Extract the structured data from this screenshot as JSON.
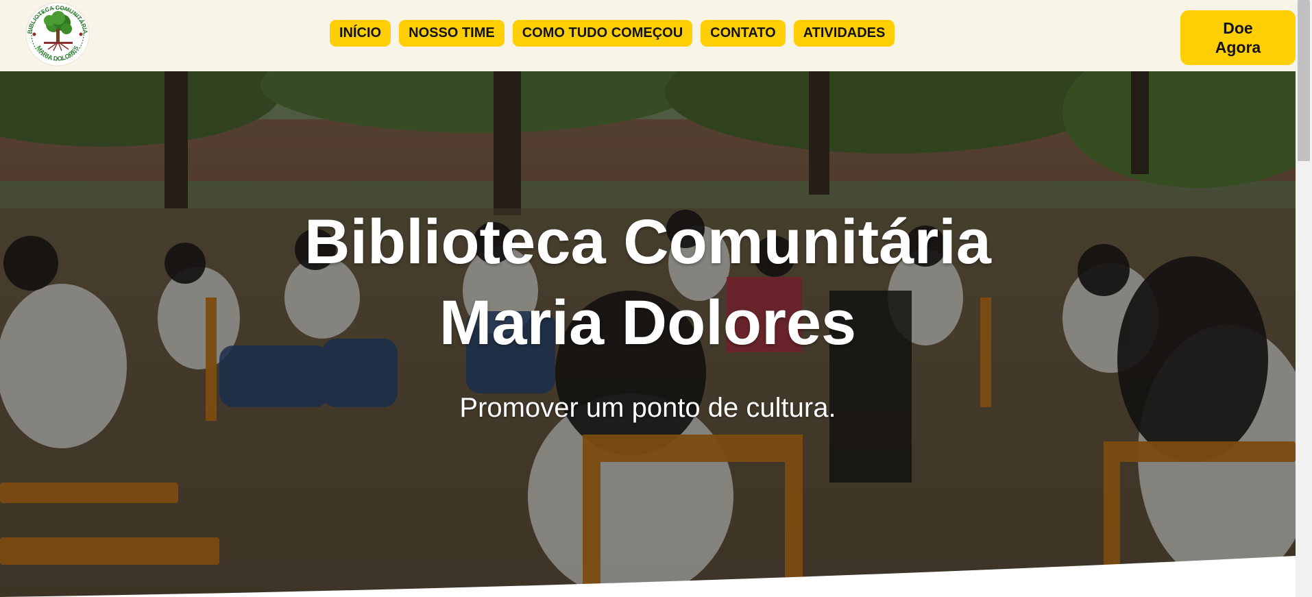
{
  "header": {
    "logo": {
      "top_text": "BIBLIOTECA COMUNITÁRIA",
      "bottom_text": "MARIA DOLORES"
    },
    "nav": [
      {
        "label": "INÍCIO"
      },
      {
        "label": "NOSSO TIME"
      },
      {
        "label": "COMO TUDO COMEÇOU"
      },
      {
        "label": "CONTATO"
      },
      {
        "label": "ATIVIDADES"
      }
    ],
    "donate": {
      "line1": "Doe",
      "line2": "Agora"
    }
  },
  "hero": {
    "title_line1": "Biblioteca Comunitária",
    "title_line2": "Maria Dolores",
    "subtitle": "Promover um ponto de cultura."
  },
  "colors": {
    "header_bg": "#f8f4e8",
    "accent": "#ffcf06",
    "hero_text": "#ffffff"
  }
}
